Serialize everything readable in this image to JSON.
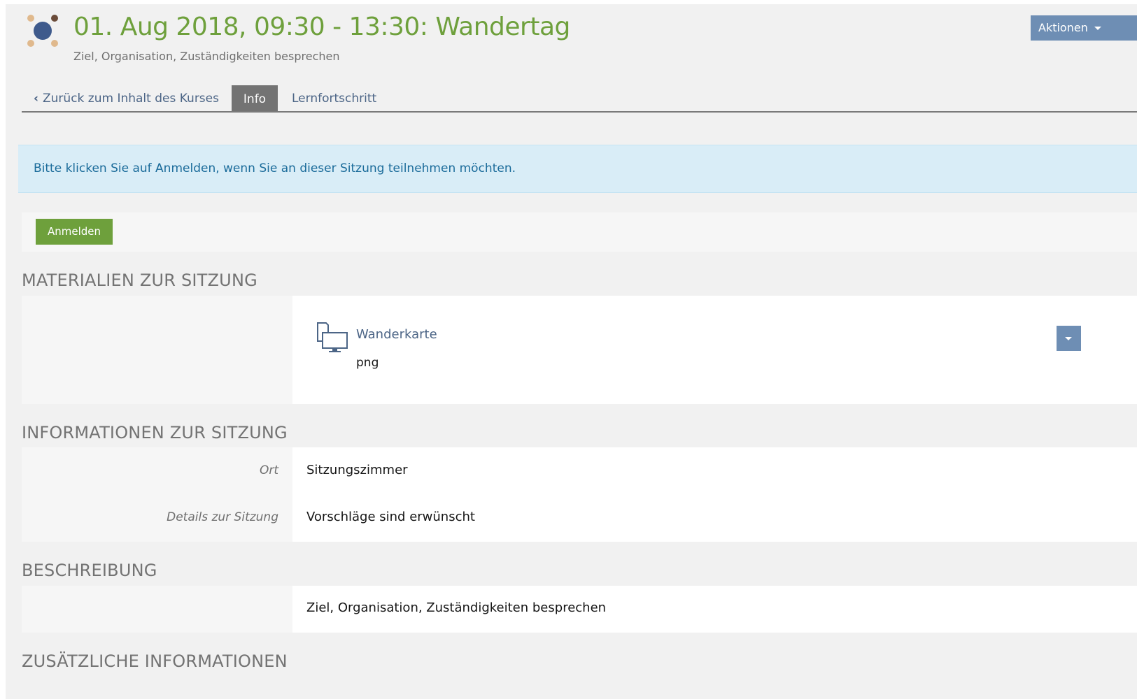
{
  "header": {
    "title": "01. Aug 2018, 09:30 - 13:30: Wandertag",
    "subtitle": "Ziel, Organisation, Zuständigkeiten besprechen",
    "actions_label": "Aktionen",
    "logo_icon": "session-object-icon"
  },
  "tabs": {
    "back_label": "Zurück zum Inhalt des Kurses",
    "info_label": "Info",
    "progress_label": "Lernfortschritt",
    "active": "Info"
  },
  "alert": {
    "text": "Bitte klicken Sie auf Anmelden, wenn Sie an dieser Sitzung teilnehmen möchten."
  },
  "toolbar": {
    "register_label": "Anmelden"
  },
  "materials": {
    "title": "MATERIALIEN ZUR SITZUNG",
    "items": [
      {
        "name": "Wanderkarte",
        "type": "png",
        "icon": "file-icon"
      }
    ]
  },
  "info": {
    "title": "INFORMATIONEN ZUR SITZUNG",
    "fields": [
      {
        "label": "Ort",
        "value": "Sitzungszimmer"
      },
      {
        "label": "Details zur Sitzung",
        "value": "Vorschläge sind erwünscht"
      }
    ]
  },
  "description": {
    "title": "BESCHREIBUNG",
    "text": "Ziel, Organisation, Zuständigkeiten besprechen"
  },
  "additional": {
    "title": "ZUSÄTZLICHE INFORMATIONEN"
  },
  "colors": {
    "title_green": "#6ea03c",
    "button_blue": "#6e8eb4",
    "link_blue": "#4c6586",
    "alert_bg": "#d9edf7",
    "alert_text": "#1a6b9a"
  }
}
